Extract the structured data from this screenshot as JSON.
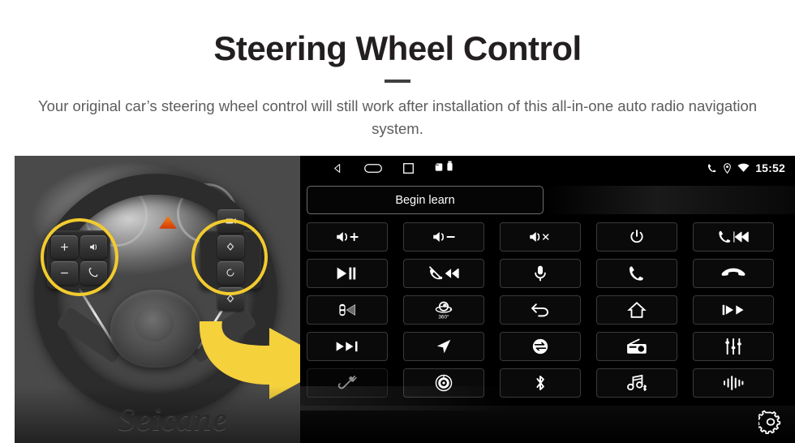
{
  "header": {
    "title": "Steering Wheel Control",
    "subtitle": "Your original car’s steering wheel control will still work after installation of this all-in-one auto radio navigation system.",
    "accent_color": "#f2cb2e",
    "title_color": "#231f20"
  },
  "photo": {
    "alt": "Car steering wheel with highlighted control buttons",
    "watermark": "Seicane",
    "highlight_color": "#f2cb2e",
    "arrow_color": "#f5d13c",
    "left_pad_keys": [
      "volume-up-key",
      "voice-key",
      "volume-down-key",
      "phone-key"
    ],
    "right_pad_keys": [
      "media-key",
      "up-key",
      "mode-key",
      "down-key"
    ]
  },
  "head_unit": {
    "statusbar": {
      "nav_icons": [
        "back-icon",
        "home-icon",
        "recents-icon"
      ],
      "tray_icons": [
        "sd-card-icon",
        "usb-icon"
      ],
      "right_icons": [
        "phone-icon",
        "location-icon",
        "wifi-icon"
      ],
      "time": "15:52"
    },
    "learn_button": "Begin learn",
    "settings_icon": "gear-icon",
    "buttons": [
      {
        "name": "volume-up",
        "icon": "volume-up-icon"
      },
      {
        "name": "volume-down",
        "icon": "volume-down-icon"
      },
      {
        "name": "mute",
        "icon": "volume-mute-icon"
      },
      {
        "name": "power",
        "icon": "power-icon"
      },
      {
        "name": "answer-previous",
        "icon": "phone-previous-icon"
      },
      {
        "name": "play-pause",
        "icon": "play-pause-icon"
      },
      {
        "name": "reject-next",
        "icon": "phone-reject-next-icon"
      },
      {
        "name": "microphone",
        "icon": "microphone-icon"
      },
      {
        "name": "call",
        "icon": "phone-call-icon"
      },
      {
        "name": "hang-up",
        "icon": "phone-hangup-icon"
      },
      {
        "name": "rear-camera",
        "icon": "car-camera-icon"
      },
      {
        "name": "around-view",
        "icon": "camera-360-icon",
        "label": "360°"
      },
      {
        "name": "back",
        "icon": "back-arrow-icon"
      },
      {
        "name": "home",
        "icon": "home-icon"
      },
      {
        "name": "previous-track",
        "icon": "previous-track-icon"
      },
      {
        "name": "next-track",
        "icon": "next-track-icon"
      },
      {
        "name": "navigation",
        "icon": "navigation-arrow-icon"
      },
      {
        "name": "source-switch",
        "icon": "swap-mode-icon"
      },
      {
        "name": "radio",
        "icon": "radio-icon"
      },
      {
        "name": "equalizer",
        "icon": "equalizer-icon"
      },
      {
        "name": "aux-input",
        "icon": "aux-cable-icon",
        "dim": true
      },
      {
        "name": "disc",
        "icon": "disc-icon"
      },
      {
        "name": "bluetooth",
        "icon": "bluetooth-icon"
      },
      {
        "name": "bluetooth-music",
        "icon": "bluetooth-music-icon"
      },
      {
        "name": "voice-waveform",
        "icon": "waveform-icon"
      }
    ]
  }
}
